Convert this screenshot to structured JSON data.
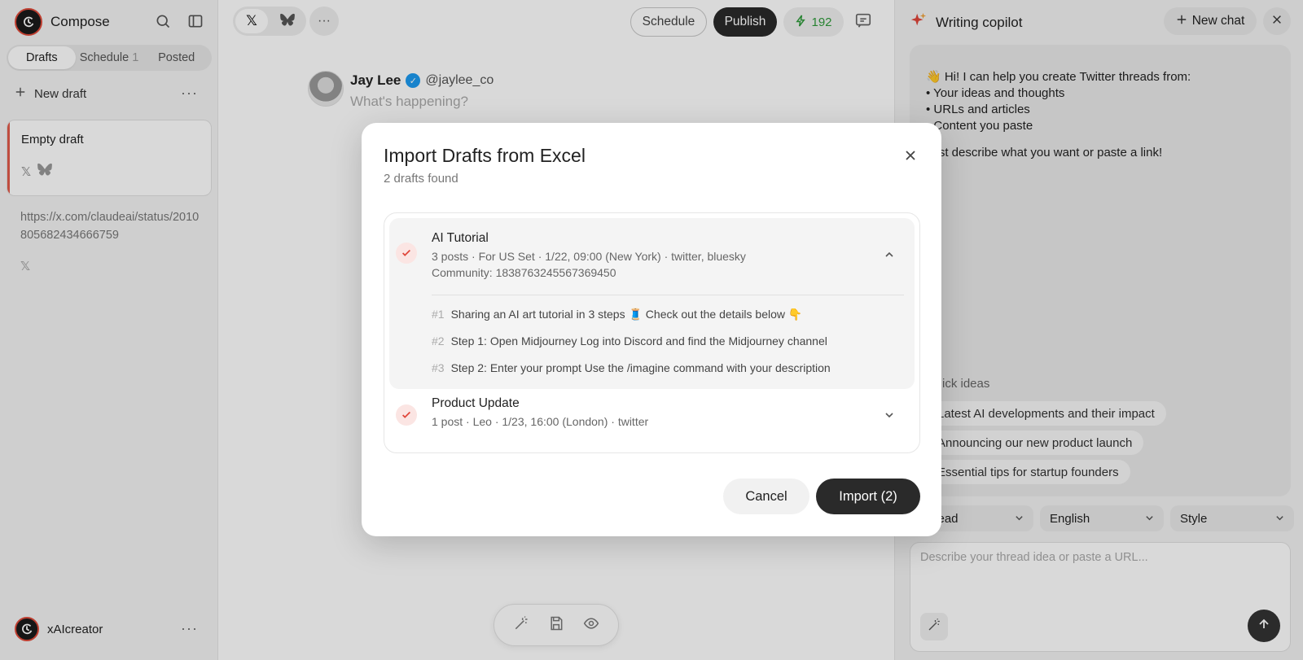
{
  "sidebar": {
    "app_name": "Compose",
    "tabs": [
      {
        "label": "Drafts"
      },
      {
        "label": "Schedule",
        "count": "1"
      },
      {
        "label": "Posted"
      }
    ],
    "new_draft_label": "New draft",
    "drafts": [
      {
        "title": "Empty draft"
      },
      {
        "title": "https://x.com/claudeai/status/2010805682434666759"
      }
    ],
    "account_name": "xAIcreator"
  },
  "main": {
    "schedule_label": "Schedule",
    "publish_label": "Publish",
    "credits": "192",
    "author_name": "Jay Lee",
    "author_handle": "@jaylee_co",
    "placeholder": "What's happening?"
  },
  "copilot": {
    "title": "Writing copilot",
    "new_chat_label": "New chat",
    "intro": "👋 Hi! I can help you create Twitter threads from:",
    "bullets": [
      "• Your ideas and thoughts",
      "• URLs and articles",
      "• Content you paste"
    ],
    "prompt": "Just describe what you want or paste a link!",
    "quick_ideas_label": "Quick ideas",
    "quick_ideas": [
      "Latest AI developments and their impact",
      "Announcing our new product launch",
      "Essential tips for startup founders"
    ],
    "format_select": "Thread",
    "language_select": "English",
    "style_select": "Style",
    "input_placeholder": "Describe your thread idea or paste a URL..."
  },
  "modal": {
    "title": "Import Drafts from Excel",
    "subtitle": "2 drafts found",
    "items": [
      {
        "title": "AI Tutorial",
        "meta": "3 posts · For US Set · 1/22, 09:00 (New York) · twitter, bluesky",
        "community": "Community: 1838763245567369450",
        "posts": [
          {
            "num": "#1",
            "text": "Sharing an AI art tutorial in 3 steps 🧵 Check out the details below 👇"
          },
          {
            "num": "#2",
            "text": "Step 1: Open Midjourney Log into Discord and find the Midjourney channel"
          },
          {
            "num": "#3",
            "text": "Step 2: Enter your prompt Use the /imagine command with your description"
          }
        ]
      },
      {
        "title": "Product Update",
        "meta": "1 post · Leo · 1/23, 16:00 (London) · twitter"
      }
    ],
    "cancel_label": "Cancel",
    "import_label": "Import (2)"
  }
}
